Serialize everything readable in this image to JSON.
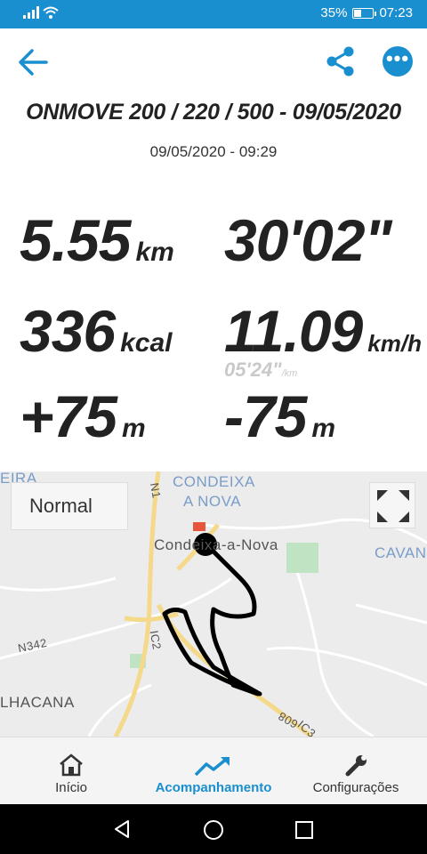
{
  "status": {
    "battery": "35%",
    "time": "07:23"
  },
  "header": {
    "title": "ONMOVE 200 / 220 / 500 - 09/05/2020",
    "datetime": "09/05/2020 - 09:29"
  },
  "stats": {
    "distance": {
      "value": "5.55",
      "unit": "km"
    },
    "duration": {
      "value": "30'02\""
    },
    "calories": {
      "value": "336",
      "unit": "kcal"
    },
    "speed": {
      "value": "11.09",
      "unit": "km/h"
    },
    "pace": {
      "value": "05'24\"",
      "unit": "/km"
    },
    "ascent": {
      "value": "+75",
      "unit": "m"
    },
    "descent": {
      "value": "-75",
      "unit": "m"
    }
  },
  "map": {
    "mode": "Normal",
    "labels": {
      "eira": "EIRA",
      "condeixa_a": "CONDEIXA",
      "condeixa_b": "A NOVA",
      "town": "Condeixa-a-Nova",
      "cavan": "CAVAN",
      "lhacana": "LHACANA",
      "n342": "N342",
      "n1": "N1",
      "ic2": "IC2",
      "ic3": "IC3",
      "r608": "608"
    }
  },
  "nav": {
    "items": [
      {
        "label": "Início",
        "icon": "home-icon"
      },
      {
        "label": "Acompanhamento",
        "icon": "trend-icon"
      },
      {
        "label": "Configurações",
        "icon": "wrench-icon"
      }
    ]
  },
  "colors": {
    "accent": "#1a8fd0",
    "route": "#000000",
    "road": "#f5d98a"
  }
}
